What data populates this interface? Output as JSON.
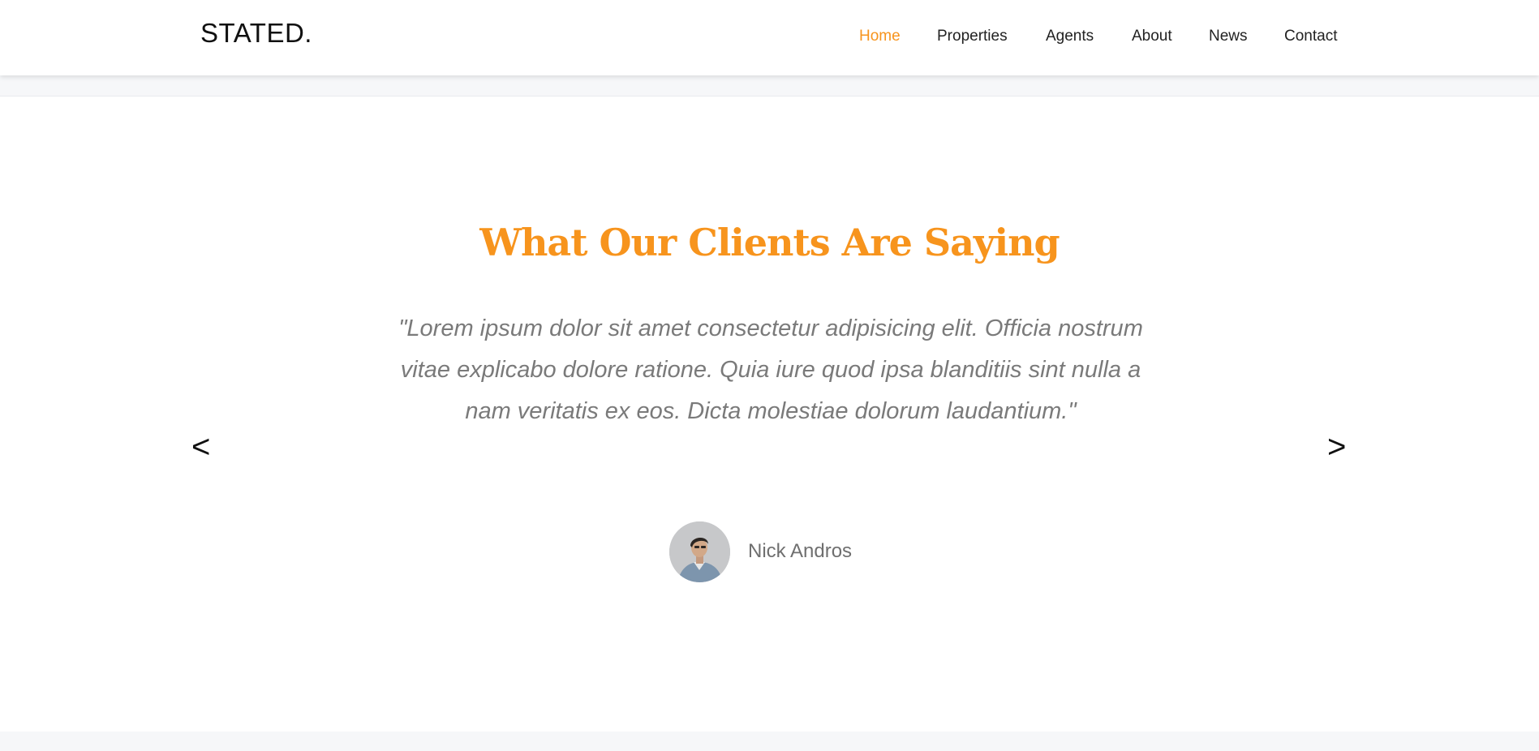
{
  "brand": {
    "logo": "STATED."
  },
  "nav": {
    "items": [
      {
        "label": "Home",
        "active": true
      },
      {
        "label": "Properties",
        "active": false
      },
      {
        "label": "Agents",
        "active": false
      },
      {
        "label": "About",
        "active": false
      },
      {
        "label": "News",
        "active": false
      },
      {
        "label": "Contact",
        "active": false
      }
    ]
  },
  "testimonial": {
    "title": "What Our Clients Are Saying",
    "quote": "\"Lorem ipsum dolor sit amet consectetur adipisicing elit. Officia nostrum vitae explicabo dolore ratione. Quia iure quod ipsa blanditiis sint nulla a nam veritatis ex eos. Dicta molestiae dolorum laudantium.\"",
    "author": "Nick Andros",
    "prev_label": "<",
    "next_label": ">"
  },
  "colors": {
    "accent": "#f7941d",
    "text": "#222222",
    "muted": "#7a7a7a",
    "band": "#f6f7f9"
  },
  "icons": {
    "prev": "chevron-left-icon",
    "next": "chevron-right-icon"
  }
}
